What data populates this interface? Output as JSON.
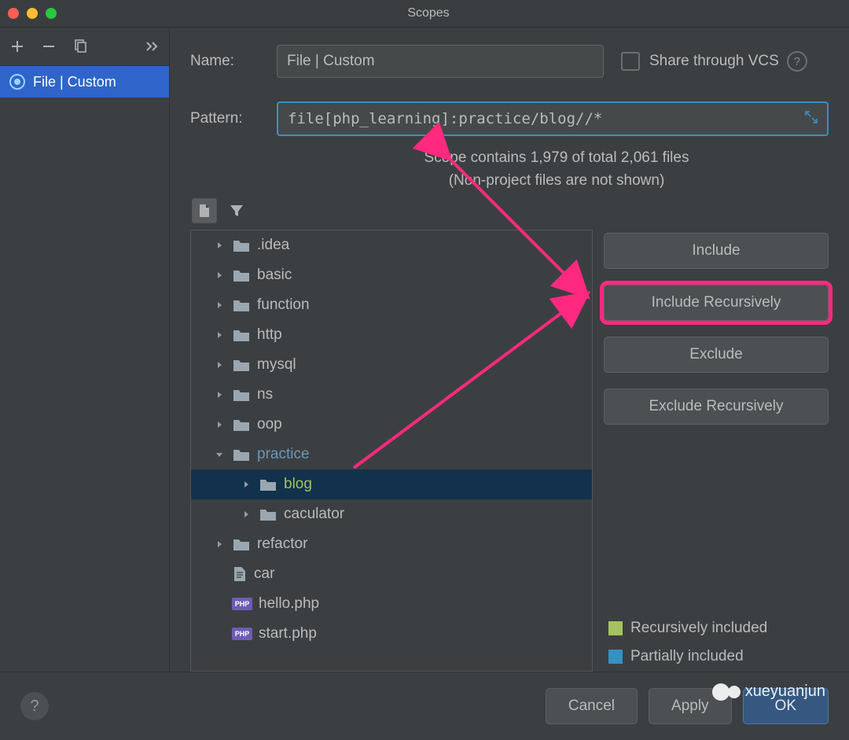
{
  "title": "Scopes",
  "sidebar": {
    "items": [
      {
        "label": "File | Custom"
      }
    ]
  },
  "form": {
    "name_label": "Name:",
    "name_value": "File | Custom",
    "share_label": "Share through VCS",
    "pattern_label": "Pattern:",
    "pattern_value": "file[php_learning]:practice/blog//*",
    "scope_info_l1": "Scope contains 1,979 of total 2,061 files",
    "scope_info_l2": "(Non-project files are not shown)"
  },
  "tree": [
    {
      "name": ".idea",
      "depth": 1,
      "type": "folder",
      "expanded": false
    },
    {
      "name": "basic",
      "depth": 1,
      "type": "folder",
      "expanded": false
    },
    {
      "name": "function",
      "depth": 1,
      "type": "folder",
      "expanded": false
    },
    {
      "name": "http",
      "depth": 1,
      "type": "folder",
      "expanded": false
    },
    {
      "name": "mysql",
      "depth": 1,
      "type": "folder",
      "expanded": false
    },
    {
      "name": "ns",
      "depth": 1,
      "type": "folder",
      "expanded": false
    },
    {
      "name": "oop",
      "depth": 1,
      "type": "folder",
      "expanded": false
    },
    {
      "name": "practice",
      "depth": 1,
      "type": "folder",
      "expanded": true,
      "color": "blue"
    },
    {
      "name": "blog",
      "depth": 2,
      "type": "folder",
      "expanded": false,
      "color": "green",
      "selected": true
    },
    {
      "name": "caculator",
      "depth": 2,
      "type": "folder",
      "expanded": false
    },
    {
      "name": "refactor",
      "depth": 1,
      "type": "folder",
      "expanded": false
    },
    {
      "name": "car",
      "depth": 1,
      "type": "file"
    },
    {
      "name": "hello.php",
      "depth": 1,
      "type": "php"
    },
    {
      "name": "start.php",
      "depth": 1,
      "type": "php"
    }
  ],
  "actions": {
    "include": "Include",
    "include_rec": "Include Recursively",
    "exclude": "Exclude",
    "exclude_rec": "Exclude Recursively"
  },
  "legend": {
    "rec": "Recursively included",
    "part": "Partially included"
  },
  "footer": {
    "cancel": "Cancel",
    "apply": "Apply",
    "ok": "OK"
  },
  "watermark": "xueyuanjun",
  "php_badge": "PHP"
}
